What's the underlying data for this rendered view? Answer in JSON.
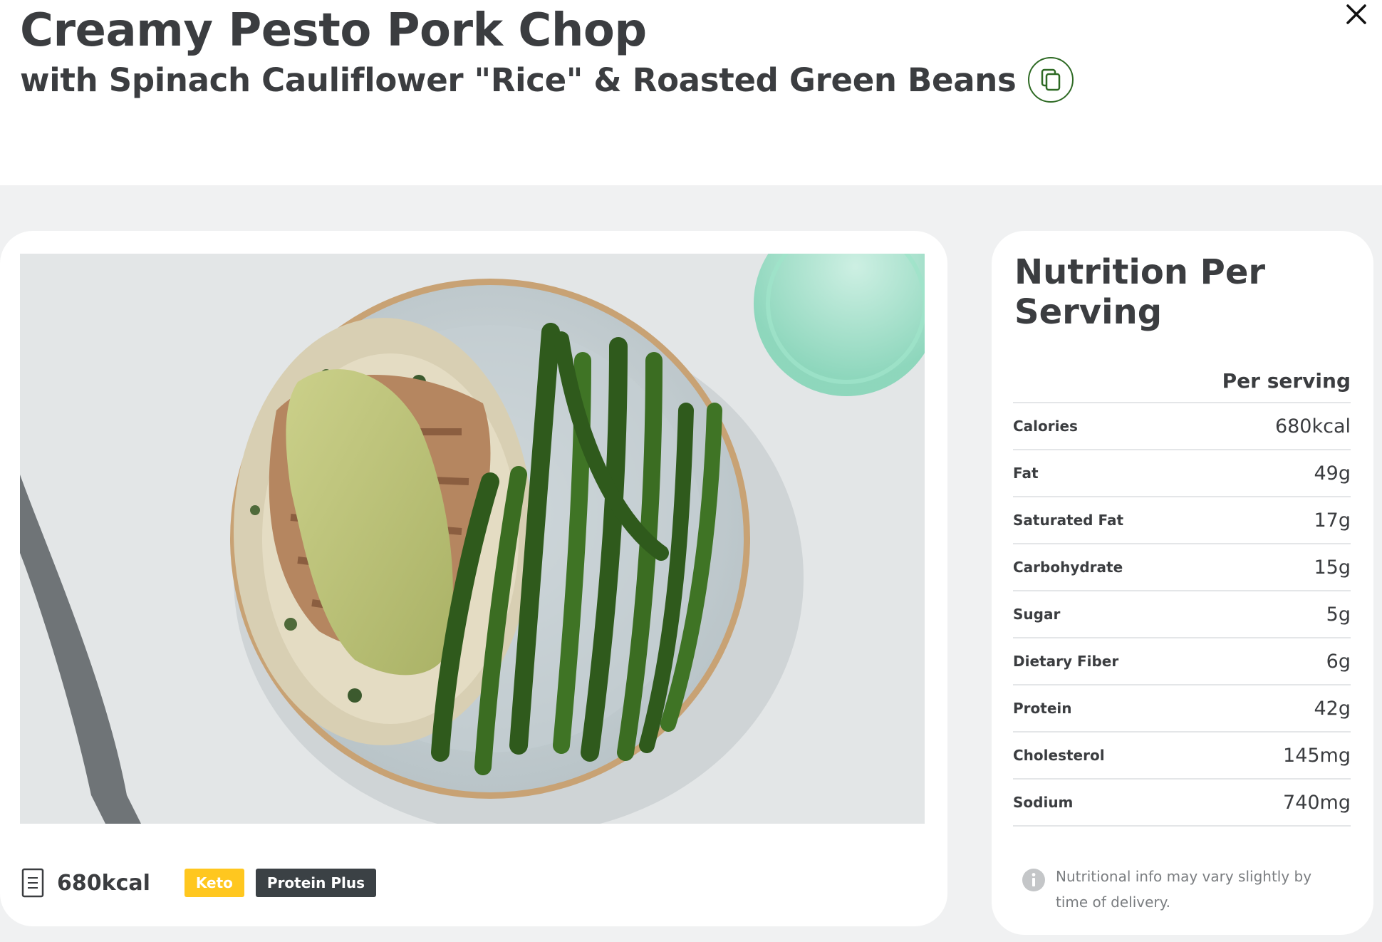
{
  "header": {
    "title": "Creamy Pesto Pork Chop",
    "subtitle": "with Spinach Cauliflower \"Rice\" & Roasted Green Beans",
    "copy_icon": "copy-icon",
    "close_icon": "close-icon"
  },
  "recipe": {
    "image_alt": "Plated pork chop with pesto sauce, cauliflower rice and green beans",
    "calories": "680kcal",
    "calories_icon": "recipe-card-icon",
    "tags": [
      {
        "label": "Keto",
        "color": "#ffc71f"
      },
      {
        "label": "Protein Plus",
        "color": "#3b4145"
      }
    ]
  },
  "nutrition": {
    "title": "Nutrition Per Serving",
    "column_header": "Per serving",
    "rows": [
      {
        "label": "Calories",
        "value": "680kcal"
      },
      {
        "label": "Fat",
        "value": "49g"
      },
      {
        "label": "Saturated Fat",
        "value": "17g"
      },
      {
        "label": "Carbohydrate",
        "value": "15g"
      },
      {
        "label": "Sugar",
        "value": "5g"
      },
      {
        "label": "Dietary Fiber",
        "value": "6g"
      },
      {
        "label": "Protein",
        "value": "42g"
      },
      {
        "label": "Cholesterol",
        "value": "145mg"
      },
      {
        "label": "Sodium",
        "value": "740mg"
      }
    ],
    "disclaimer": "Nutritional info may vary slightly by time of delivery.",
    "info_icon": "info-icon"
  },
  "colors": {
    "accent_green": "#2e6a24",
    "keto_yellow": "#ffc71f",
    "dark_tag": "#3b4145",
    "backdrop": "#f0f1f2"
  }
}
